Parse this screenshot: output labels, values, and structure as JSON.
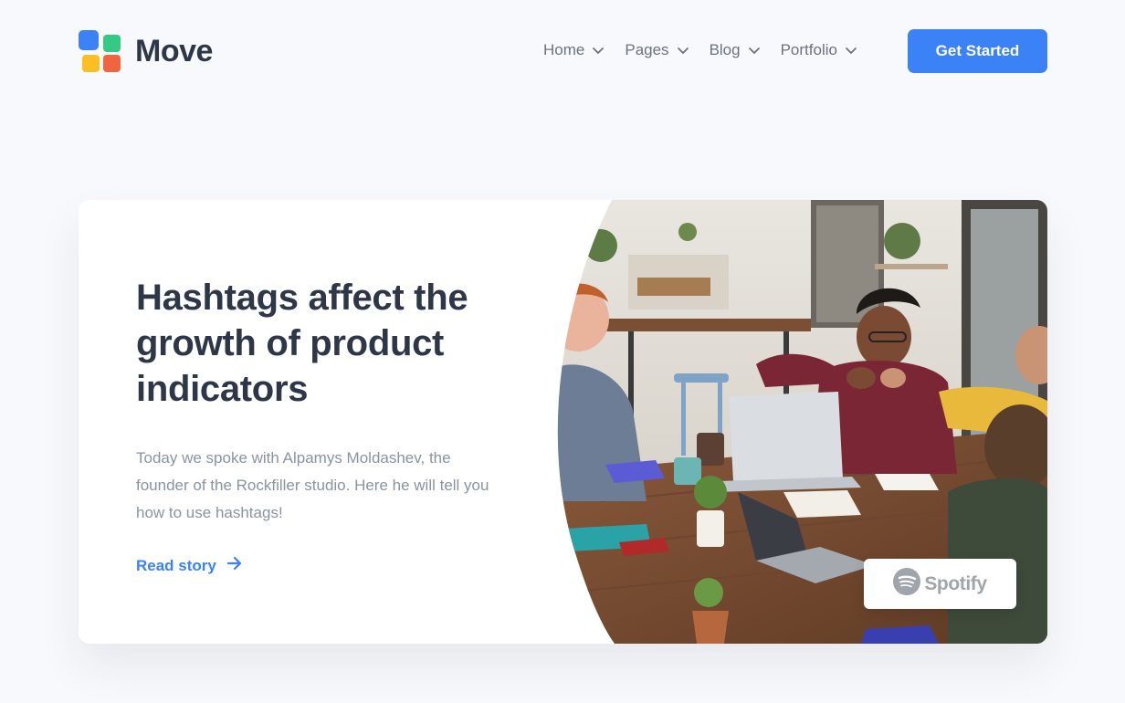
{
  "brand": {
    "name": "Move",
    "logo_colors": {
      "blue": "#3b82f6",
      "green": "#34c985",
      "yellow": "#fbbf24",
      "red": "#f06440"
    }
  },
  "nav": {
    "items": [
      {
        "label": "Home",
        "icon": "chevron-down-icon"
      },
      {
        "label": "Pages",
        "icon": "chevron-down-icon"
      },
      {
        "label": "Blog",
        "icon": "chevron-down-icon"
      },
      {
        "label": "Portfolio",
        "icon": "chevron-down-icon"
      }
    ],
    "cta_label": "Get Started"
  },
  "hero": {
    "headline": "Hashtags affect the growth of product indicators",
    "description": "Today we spoke with Alpamys Moldashev, the founder of the Rockfiller studio. Here he will tell you how to use hashtags!",
    "link_label": "Read story",
    "link_icon": "arrow-right-icon",
    "photo_icon": "team-meeting-photo",
    "badge_label": "Spotify",
    "badge_icon": "spotify-icon"
  },
  "colors": {
    "accent": "#3b82f6",
    "page_bg": "#f8f9fc",
    "heading": "#2d3748",
    "muted": "#8a93a3"
  }
}
